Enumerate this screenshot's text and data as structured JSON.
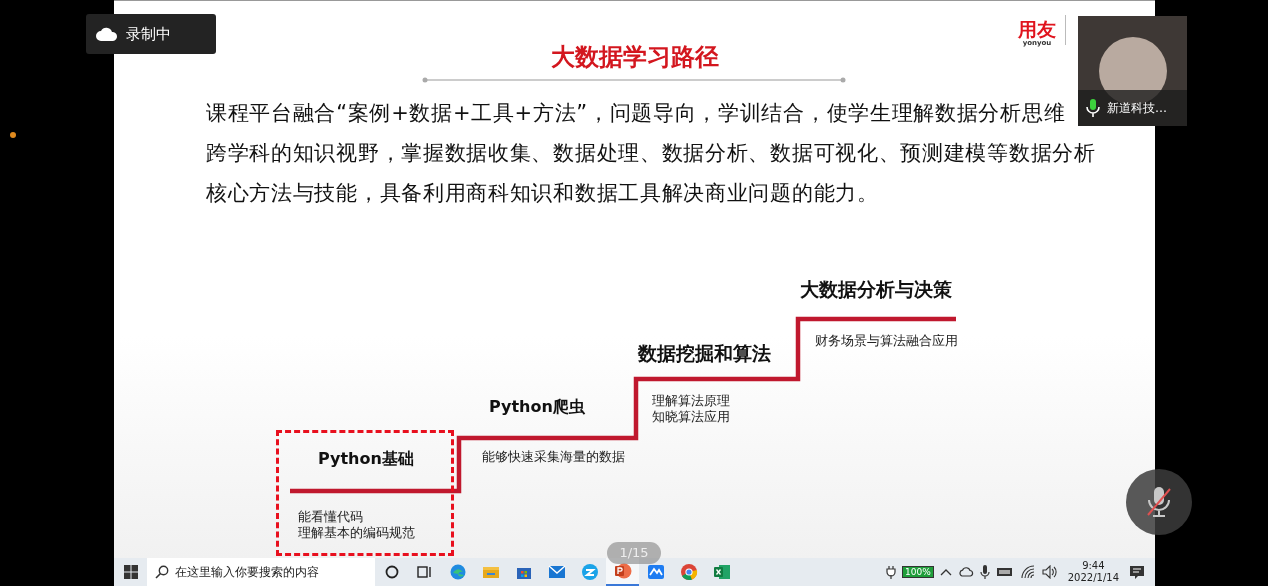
{
  "recording": {
    "label": "录制中"
  },
  "slide": {
    "logo": {
      "brand": "用友",
      "sub": "yonyou"
    },
    "title": "大数据学习路径",
    "paragraph": [
      "课程平台融合“案例+数据+工具+方法”，问题导向，学训结合，使学生理解数据分析思维",
      "跨学科的知识视野，掌握数据收集、数据处理、数据分析、数据可视化、预测建模等数据分析",
      "核心方法与技能，具备利用商科知识和数据工具解决商业问题的能力。"
    ],
    "steps": [
      {
        "title": "Python基础",
        "lines": [
          "能看懂代码",
          "理解基本的编码规范"
        ],
        "selected": true
      },
      {
        "title": "Python爬虫",
        "lines": [
          "能够快速采集海量的数据"
        ],
        "selected": false
      },
      {
        "title": "数据挖掘和算法",
        "lines": [
          "理解算法原理",
          "知晓算法应用"
        ],
        "selected": false
      },
      {
        "title": "大数据分析与决策",
        "lines": [
          "财务场景与算法融合应用"
        ],
        "selected": false
      }
    ],
    "page_indicator": "1/15"
  },
  "participant": {
    "name": "新道科技…",
    "muted": false
  },
  "self_mic": {
    "muted": true
  },
  "taskbar": {
    "search_placeholder": "在这里输入你要搜索的内容",
    "apps": [
      {
        "kind": "cortana",
        "selected": false
      },
      {
        "kind": "taskview",
        "selected": false
      },
      {
        "kind": "edge",
        "selected": false
      },
      {
        "kind": "explorer",
        "selected": false
      },
      {
        "kind": "store",
        "selected": false
      },
      {
        "kind": "mail",
        "selected": false
      },
      {
        "kind": "browser",
        "selected": false
      },
      {
        "kind": "powerpoint",
        "selected": true
      },
      {
        "kind": "meeting",
        "selected": false
      },
      {
        "kind": "chrome",
        "selected": false
      },
      {
        "kind": "excel",
        "selected": false
      }
    ],
    "battery": "100%",
    "time": "9:44",
    "date": "2022/1/14"
  }
}
